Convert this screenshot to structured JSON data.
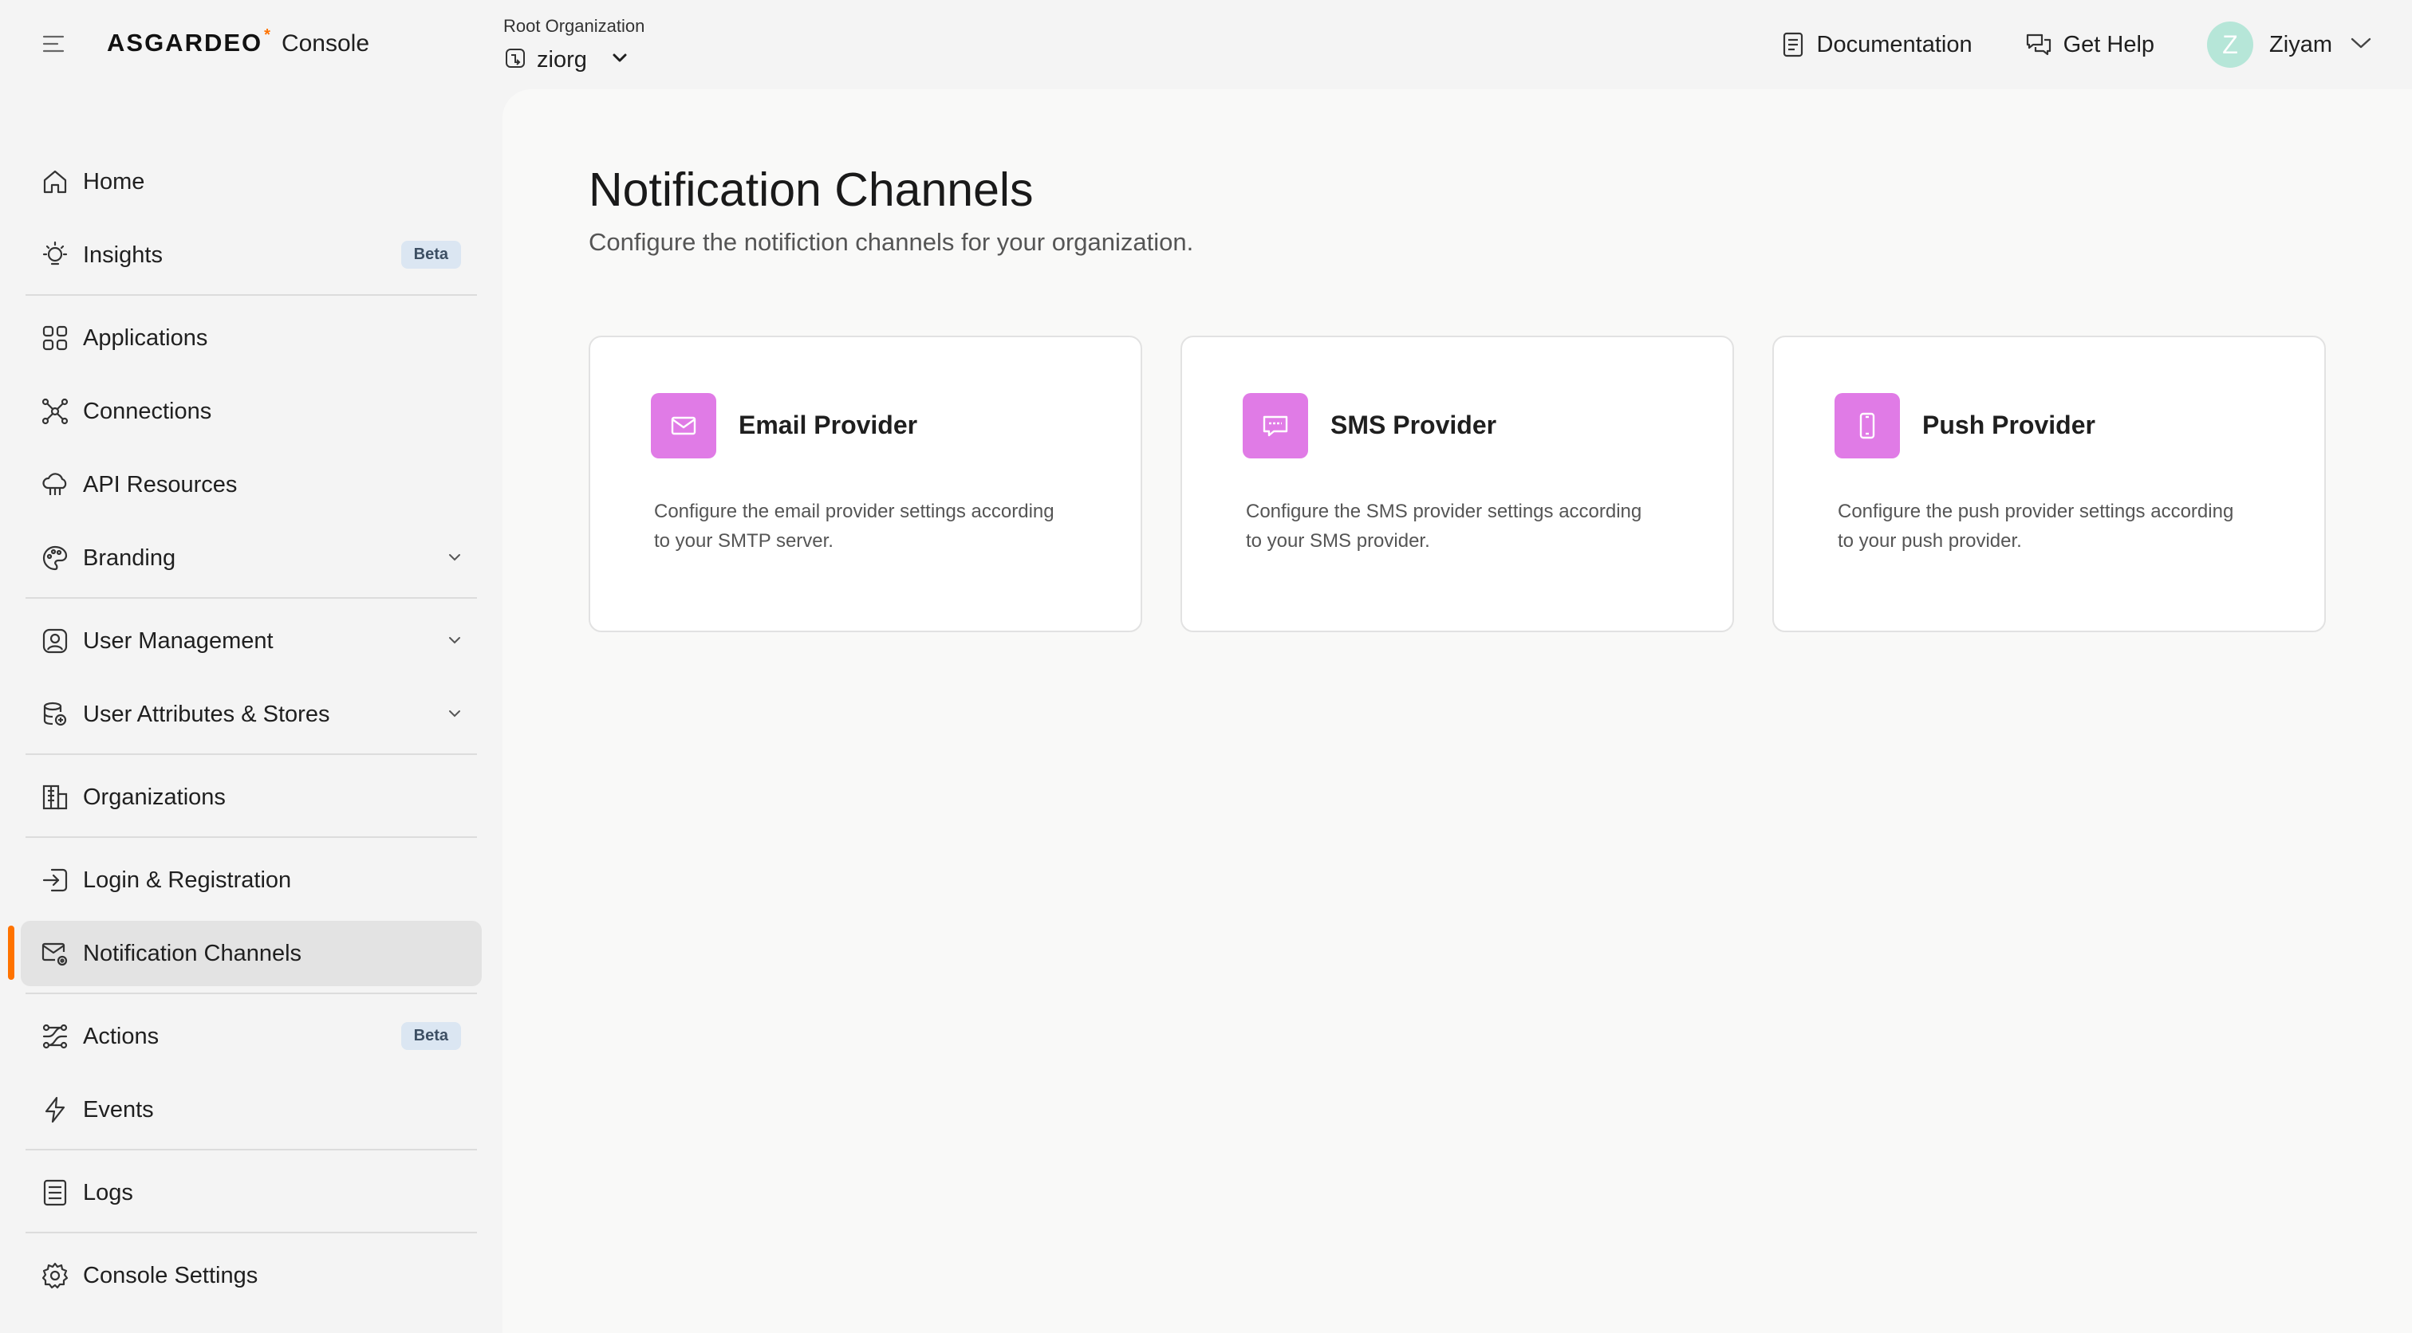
{
  "header": {
    "logo_text": "ASGARDEO",
    "logo_mark": "*",
    "console_label": "Console",
    "org_label": "Root Organization",
    "org_name": "ziorg",
    "documentation_label": "Documentation",
    "help_label": "Get Help",
    "avatar_initial": "Z",
    "user_name": "Ziyam"
  },
  "sidebar": {
    "items": [
      {
        "label": "Home",
        "icon": "home-icon"
      },
      {
        "label": "Insights",
        "icon": "lightbulb-icon",
        "badge": "Beta"
      },
      {
        "label": "Applications",
        "icon": "grid-icon"
      },
      {
        "label": "Connections",
        "icon": "connections-icon"
      },
      {
        "label": "API Resources",
        "icon": "cloud-icon"
      },
      {
        "label": "Branding",
        "icon": "palette-icon",
        "expandable": true
      },
      {
        "label": "User Management",
        "icon": "user-icon",
        "expandable": true
      },
      {
        "label": "User Attributes & Stores",
        "icon": "database-icon",
        "expandable": true
      },
      {
        "label": "Organizations",
        "icon": "building-icon"
      },
      {
        "label": "Login & Registration",
        "icon": "login-icon"
      },
      {
        "label": "Notification Channels",
        "icon": "mail-settings-icon",
        "active": true
      },
      {
        "label": "Actions",
        "icon": "actions-icon",
        "badge": "Beta"
      },
      {
        "label": "Events",
        "icon": "lightning-icon"
      },
      {
        "label": "Logs",
        "icon": "logs-icon"
      },
      {
        "label": "Console Settings",
        "icon": "gear-icon"
      }
    ]
  },
  "main": {
    "title": "Notification Channels",
    "subtitle": "Configure the notifiction channels for your organization.",
    "cards": [
      {
        "title": "Email Provider",
        "description": "Configure the email provider settings according to your SMTP server.",
        "icon": "mail-icon"
      },
      {
        "title": "SMS Provider",
        "description": "Configure the SMS provider settings according to your SMS provider.",
        "icon": "sms-icon"
      },
      {
        "title": "Push Provider",
        "description": "Configure the push provider settings according to your push provider.",
        "icon": "phone-icon"
      }
    ]
  },
  "colors": {
    "accent": "#ff7300",
    "card_icon_bg": "#e07be6",
    "badge_bg": "#dbe6f2",
    "active_item_bg": "#e3e3e3",
    "avatar_bg": "#b6e6d8"
  }
}
